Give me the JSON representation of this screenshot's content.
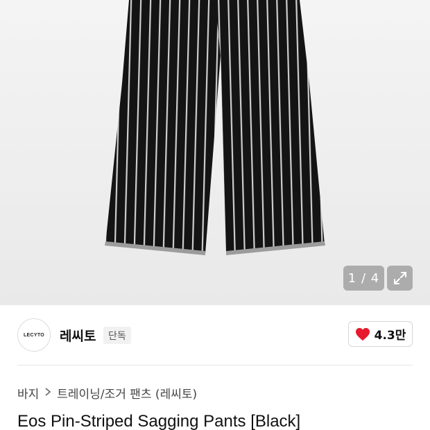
{
  "gallery": {
    "counter": "1 / 4",
    "expand_icon": "expand-icon"
  },
  "brand": {
    "logo_text": "LECYTO",
    "name": "레씨토",
    "exclusive_badge": "단독",
    "likes": "4.3만",
    "like_icon": "heart-icon",
    "like_color": "#e8192c"
  },
  "breadcrumb": {
    "items": [
      "바지",
      "트레이닝/조거 팬츠 (레씨토)"
    ],
    "separator_icon": "chevron-right-icon"
  },
  "product": {
    "title": "Eos Pin-Striped Sagging Pants  [Black]"
  }
}
